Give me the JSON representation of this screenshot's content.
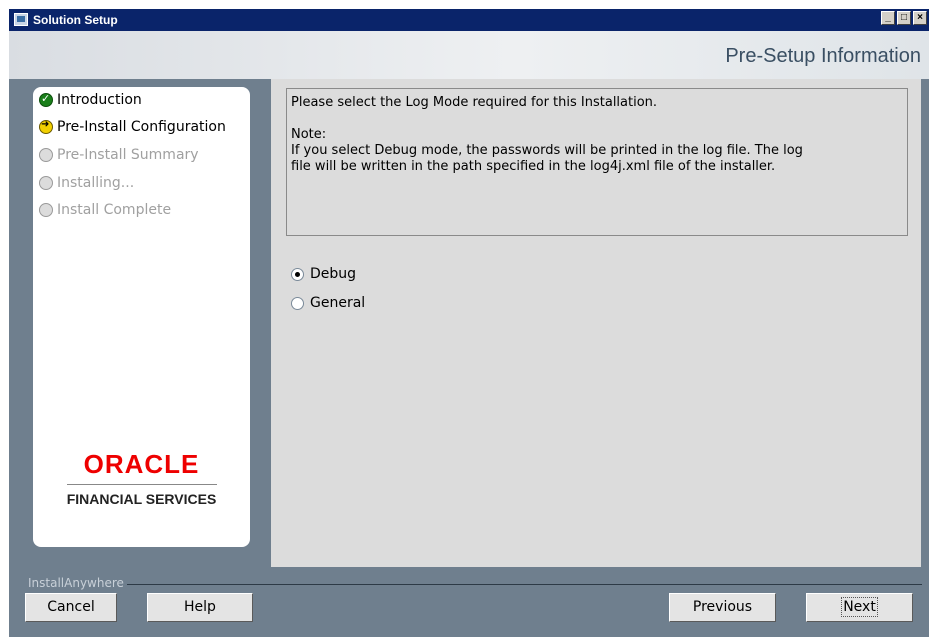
{
  "window": {
    "title": "Solution Setup",
    "controls": {
      "minimize": "_",
      "maximize": "□",
      "close": "×"
    }
  },
  "header": {
    "heading": "Pre-Setup Information"
  },
  "steps": [
    {
      "label": "Introduction",
      "state": "done"
    },
    {
      "label": "Pre-Install Configuration",
      "state": "current"
    },
    {
      "label": "Pre-Install Summary",
      "state": "pending"
    },
    {
      "label": "Installing...",
      "state": "pending"
    },
    {
      "label": "Install Complete",
      "state": "pending"
    }
  ],
  "logo": {
    "brand": "ORACLE",
    "subtitle": "FINANCIAL SERVICES"
  },
  "content": {
    "instruction": "Please select the Log Mode required for this Installation.",
    "note_label": "Note:",
    "note_line1": "If you select Debug mode, the passwords will be printed in the log file. The log",
    "note_line2": "file will be written in the path specified in the log4j.xml file of the installer.",
    "options": [
      {
        "label": "Debug",
        "selected": true
      },
      {
        "label": "General",
        "selected": false
      }
    ]
  },
  "footer": {
    "brand": "InstallAnywhere",
    "cancel_label": "Cancel",
    "help_label": "Help",
    "previous_label": "Previous",
    "next_label": "Next"
  },
  "colors": {
    "title_bar": "#0a246a",
    "accent_red": "#e00000",
    "panel_bg": "#dcdcdc",
    "frame_bg": "#6f7f8e"
  }
}
